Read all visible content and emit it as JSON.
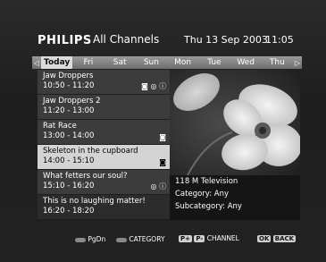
{
  "header": {
    "brand": "PHILIPS",
    "channel_group": "All Channels",
    "date": "Thu 13 Sep 2003",
    "clock": "11:05"
  },
  "days": {
    "left_arrow": "◁",
    "right_arrow": "▷",
    "items": [
      "Today",
      "Fri",
      "Sat",
      "Sun",
      "Mon",
      "Tue",
      "Wed",
      "Thu"
    ],
    "selected": 0
  },
  "programs": [
    {
      "title": "Jaw Droppers",
      "time": "10:50 - 11:20",
      "icons": "◙ ◎ ⓘ"
    },
    {
      "title": "Jaw Droppers 2",
      "time": "11:20 - 13:00",
      "icons": ""
    },
    {
      "title": "Rat Race",
      "time": "13:00 - 14:00",
      "icons": "◙"
    },
    {
      "title": "Skeleton in the cupboard",
      "time": "14:00 - 15:10",
      "icons": "◙"
    },
    {
      "title": "What fetters our soul?",
      "time": "15:10 - 16:20",
      "icons": "◎ ⓘ"
    },
    {
      "title": "This is no laughing matter!",
      "time": "16:20 - 18:20",
      "icons": ""
    }
  ],
  "selected_program": 3,
  "details": {
    "channel": "118 M Television",
    "category": "Category: Any",
    "subcategory": "Subcategory: Any"
  },
  "footer": {
    "pgdn": "PgDn",
    "category": "CATEGORY",
    "p_plus": "P+",
    "p_minus": "P-",
    "channel": "CHANNEL",
    "ok": "OK",
    "back": "BACK"
  }
}
